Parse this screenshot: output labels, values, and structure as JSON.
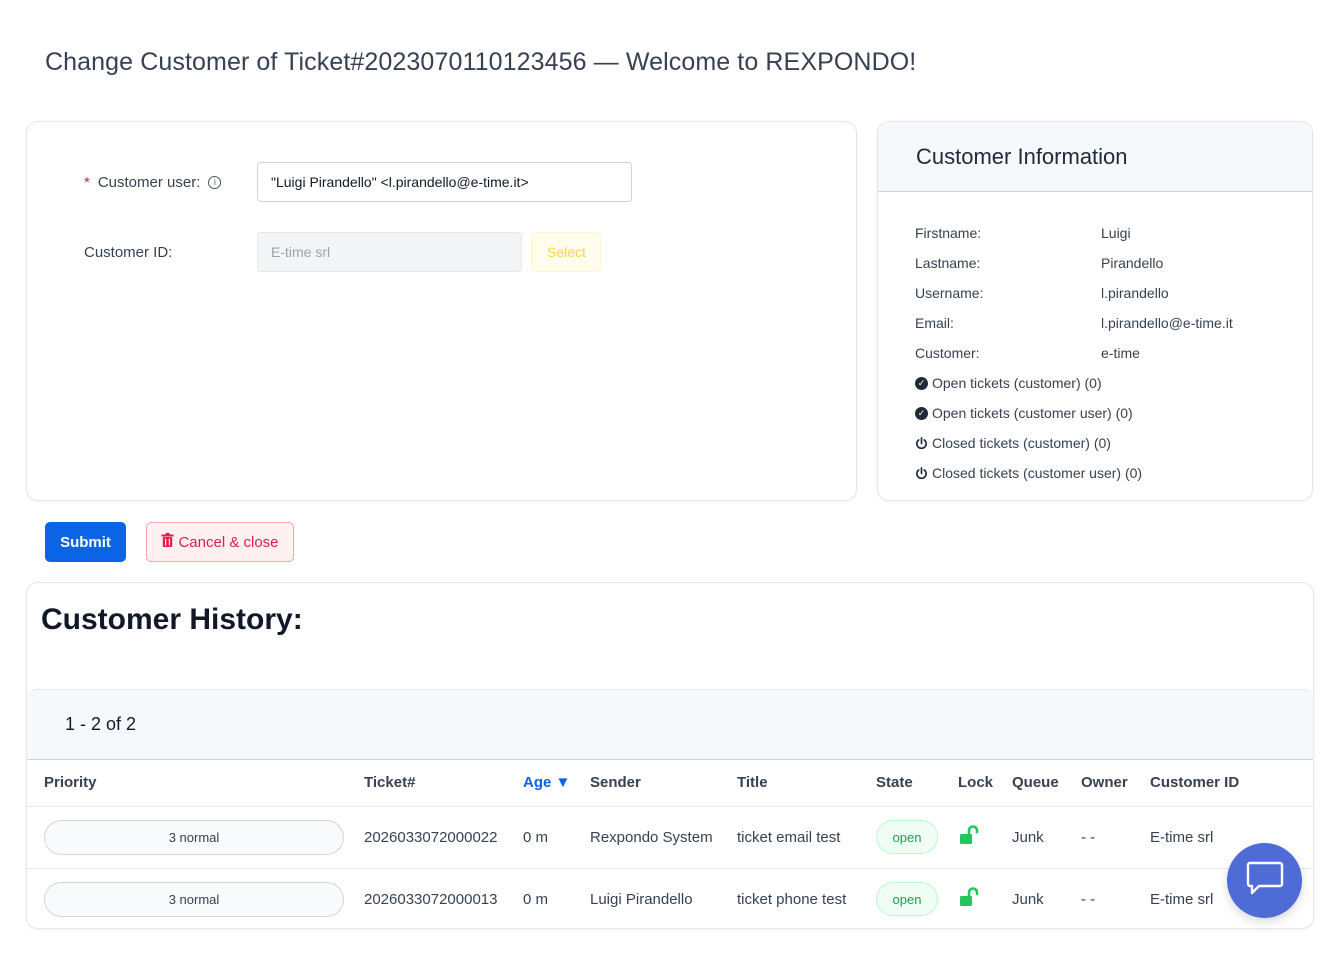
{
  "page": {
    "title": "Change Customer of Ticket#2023070110123456 — Welcome to REXPONDO!"
  },
  "form": {
    "customer_user_label": "Customer user:",
    "customer_user_value": "\"Luigi Pirandello\" <l.pirandello@e-time.it>",
    "customer_id_label": "Customer ID:",
    "customer_id_value": "E-time srl",
    "select_label": "Select"
  },
  "customer_info": {
    "title": "Customer Information",
    "fields": [
      {
        "key": "Firstname:",
        "value": "Luigi"
      },
      {
        "key": "Lastname:",
        "value": "Pirandello"
      },
      {
        "key": "Username:",
        "value": "l.pirandello"
      },
      {
        "key": "Email:",
        "value": "l.pirandello@e-time.it"
      },
      {
        "key": "Customer:",
        "value": "e-time"
      }
    ],
    "links": [
      {
        "label": "Open tickets (customer) (0)",
        "icon": "check-circle-icon"
      },
      {
        "label": "Open tickets (customer user) (0)",
        "icon": "check-circle-icon"
      },
      {
        "label": "Closed tickets (customer) (0)",
        "icon": "power-icon"
      },
      {
        "label": "Closed tickets (customer user) (0)",
        "icon": "power-icon"
      }
    ]
  },
  "actions": {
    "submit_label": "Submit",
    "cancel_label": "Cancel & close"
  },
  "history": {
    "title": "Customer History:",
    "pager": "1 - 2 of 2",
    "columns": {
      "priority": "Priority",
      "ticket": "Ticket#",
      "age": "Age",
      "sender": "Sender",
      "title": "Title",
      "state": "State",
      "lock": "Lock",
      "queue": "Queue",
      "owner": "Owner",
      "customer_id": "Customer ID"
    },
    "rows": [
      {
        "priority": "3 normal",
        "ticket": "2026033072000022",
        "age": "0 m",
        "sender": "Rexpondo System",
        "title": "ticket email test",
        "state": "open",
        "queue": "Junk",
        "owner": "- -",
        "customer_id": "E-time srl"
      },
      {
        "priority": "3 normal",
        "ticket": "2026033072000013",
        "age": "0 m",
        "sender": "Luigi Pirandello",
        "title": "ticket phone test",
        "state": "open",
        "queue": "Junk",
        "owner": "- -",
        "customer_id": "E-time srl"
      }
    ]
  },
  "colors": {
    "primary": "#0b63e5",
    "danger": "#e11d48",
    "success": "#16a34a",
    "chat": "#4f6bd6"
  }
}
